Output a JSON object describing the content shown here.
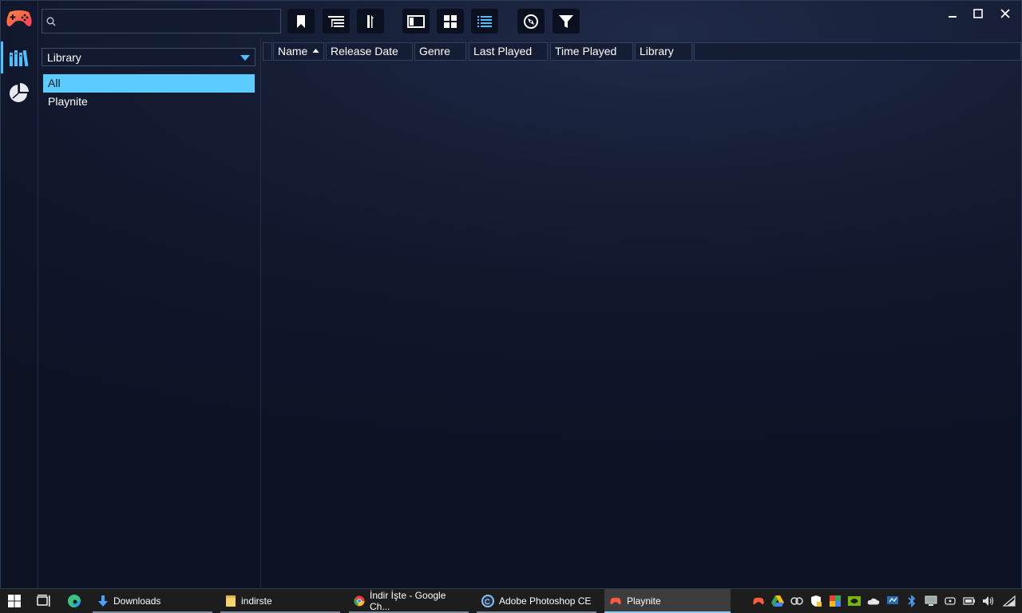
{
  "app": {
    "name": "Playnite"
  },
  "search": {
    "value": "",
    "placeholder": ""
  },
  "filter_panel": {
    "dropdown_label": "Library",
    "items": [
      "All",
      "Playnite"
    ],
    "selected_index": 0
  },
  "grid": {
    "columns": [
      "Name",
      "Release Date",
      "Genre",
      "Last Played",
      "Time Played",
      "Library"
    ],
    "sort_column": "Name",
    "sort_direction": "ascending"
  },
  "toolbar": {
    "icons": [
      "bookmark-icon",
      "list-tree-icon",
      "sort-icon",
      "sidebar-view-icon",
      "grid-view-icon",
      "details-view-icon",
      "explore-icon",
      "filter-icon"
    ]
  },
  "taskbar": {
    "apps": [
      {
        "label": "Downloads",
        "icon": "download-arrow-icon"
      },
      {
        "label": "indirste",
        "icon": "folder-icon"
      },
      {
        "label": "İndir İşte - Google Ch...",
        "icon": "chrome-icon"
      },
      {
        "label": "Adobe Photoshop CE",
        "icon": "photoshop-ce-icon"
      },
      {
        "label": "Playnite",
        "icon": "playnite-icon"
      }
    ]
  },
  "colors": {
    "accent": "#4dc2ff",
    "selection": "#5ccbff",
    "background": "#10172b",
    "logo_orange": "#ff5a3c"
  }
}
